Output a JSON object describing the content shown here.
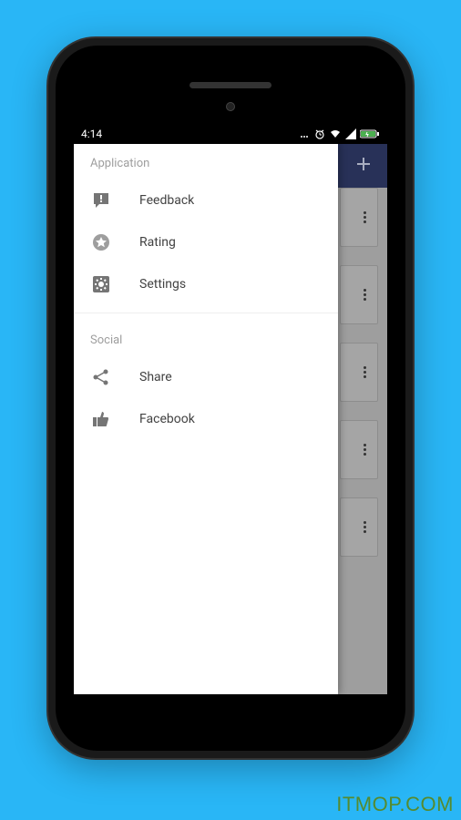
{
  "status": {
    "time": "4:14"
  },
  "drawer": {
    "sections": [
      {
        "title": "Application",
        "items": [
          {
            "icon": "feedback-icon",
            "label": "Feedback"
          },
          {
            "icon": "star-icon",
            "label": "Rating"
          },
          {
            "icon": "settings-icon",
            "label": "Settings"
          }
        ]
      },
      {
        "title": "Social",
        "items": [
          {
            "icon": "share-icon",
            "label": "Share"
          },
          {
            "icon": "thumbs-up-icon",
            "label": "Facebook"
          }
        ]
      }
    ]
  },
  "watermark": "ITMOP.COM"
}
